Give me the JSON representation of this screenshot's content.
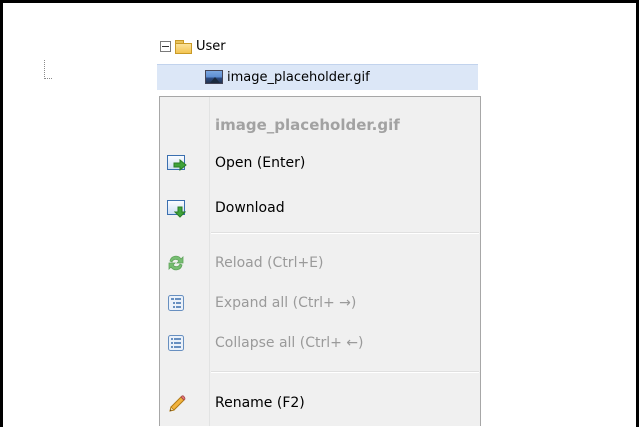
{
  "tree": {
    "root_label": "User",
    "child_label": "image_placeholder.gif"
  },
  "context_menu": {
    "title": "image_placeholder.gif",
    "items": [
      {
        "label": "Open (Enter)",
        "icon": "open-arrow-icon",
        "enabled": true
      },
      {
        "label": "Download",
        "icon": "download-icon",
        "enabled": true
      },
      {
        "label": "Reload (Ctrl+E)",
        "icon": "reload-icon",
        "enabled": false
      },
      {
        "label": "Expand all (Ctrl+ →)",
        "icon": "expand-all-icon",
        "enabled": false
      },
      {
        "label": "Collapse all (Ctrl+ ←)",
        "icon": "collapse-all-icon",
        "enabled": false
      },
      {
        "label": "Rename (F2)",
        "icon": "pencil-icon",
        "enabled": true
      }
    ]
  },
  "colors": {
    "selection": "#dce7f7",
    "menu_bg": "#f0f0f0",
    "disabled_text": "#9a9a9a",
    "icon_green": "#3fa33a",
    "icon_blue": "#3a6fb0"
  }
}
